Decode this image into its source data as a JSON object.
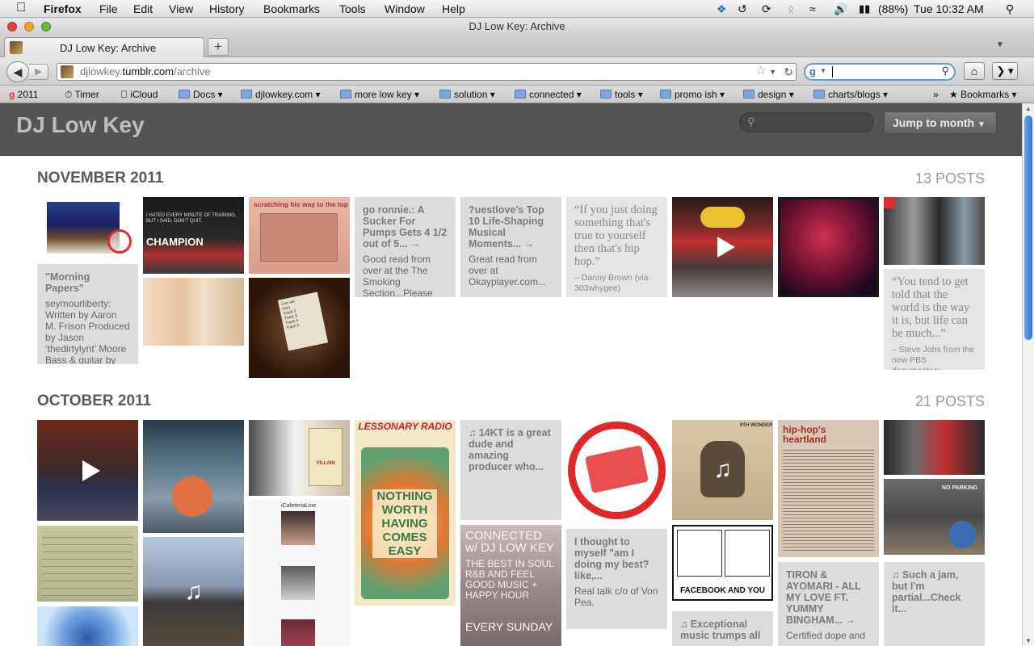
{
  "menubar": {
    "app": "Firefox",
    "items": [
      "File",
      "Edit",
      "View",
      "History",
      "Bookmarks",
      "Tools",
      "Window",
      "Help"
    ],
    "battery": "(88%)",
    "clock": "Tue 10:32 AM"
  },
  "window": {
    "title": "DJ Low Key: Archive"
  },
  "tab": {
    "label": "DJ Low Key: Archive",
    "new_tab": "+"
  },
  "address": {
    "prefix": "djlowkey.",
    "domain": "tumblr.com",
    "path": "/archive"
  },
  "search": {
    "value": ""
  },
  "bookmarks": [
    {
      "label": "2011",
      "icon": "google-icon"
    },
    {
      "label": "Timer",
      "icon": "timer-icon"
    },
    {
      "label": "iCloud",
      "icon": "apple-icon"
    },
    {
      "label": "Docs",
      "icon": "folder-icon",
      "menu": true
    },
    {
      "label": "djlowkey.com",
      "icon": "folder-icon",
      "menu": true
    },
    {
      "label": "more low key",
      "icon": "folder-icon",
      "menu": true
    },
    {
      "label": "solution",
      "icon": "folder-icon",
      "menu": true
    },
    {
      "label": "connected",
      "icon": "folder-icon",
      "menu": true
    },
    {
      "label": "tools",
      "icon": "folder-icon",
      "menu": true
    },
    {
      "label": "promo ish",
      "icon": "folder-icon",
      "menu": true
    },
    {
      "label": "design",
      "icon": "folder-icon",
      "menu": true
    },
    {
      "label": "charts/blogs",
      "icon": "folder-icon",
      "menu": true
    }
  ],
  "bookmarks_menu": "Bookmarks",
  "blog": {
    "title": "DJ Low Key",
    "jump_label": "Jump to month",
    "search_placeholder": ""
  },
  "months": [
    {
      "label": "NOVEMBER 2011",
      "count": "13 POSTS"
    },
    {
      "label": "OCTOBER 2011",
      "count": "21 POSTS"
    }
  ],
  "nov_posts": {
    "morning": {
      "title": "\"Morning Papers\"",
      "body": "seymourliberty: Written by Aaron M. Frison Produced by Jason ‘thedirtylynt’ Moore Bass & guitar by Mugpush Dont u bring me no mornin"
    },
    "ronnie": {
      "title": "go ronnie.: A Sucker For Pumps Gets 4 1/2 out of 5... →",
      "body": "Good read from over at the The Smoking Section...Please don't sleep on this"
    },
    "questlove": {
      "title": "?uestlove's Top 10 Life-Shaping Musical Moments... →",
      "body": "Great read from over at Okayplayer.com..."
    },
    "hiphop_quote": {
      "quote": "“If you just doing something that's true to yourself then that's hip hop.”",
      "source": "– Danny Brown (via 303whygee)"
    },
    "jobs_quote": {
      "quote": "“You tend to get told that the world is the way it is, but life can be much...”",
      "source": "– Steve Jobs from the new PBS documentary"
    }
  },
  "oct_posts": {
    "fourteen": {
      "title": "♫ 14KT is a great dude and amazing producer who..."
    },
    "best": {
      "title": "I thought to myself \"am I doing my best? like,...",
      "body": "Real talk c/o of Von Pea."
    },
    "tiron": {
      "title": "TIRON & AYOMARI - ALL MY LOVE FT. YUMMY BINGHAM... →",
      "body": "Certified dope and"
    },
    "jam": {
      "title": "♫ Such a jam, but I'm partial...Check it..."
    },
    "exceptional": {
      "title": "♫ Exceptional music trumps all"
    }
  },
  "image_text": {
    "scratching": "scratching his way to the top",
    "champion": "CHAMPION",
    "lessonary": "LESSONARY RADIO",
    "nothing": "NOTHING WORTH HAVING COMES EASY",
    "connected": "CONNECTED w/ DJ LOW KEY",
    "connected_sub": "THE BEST IN SOUL R&B AND FEEL GOOD MUSIC + HAPPY HOUR",
    "connected_day": "EVERY SUNDAY",
    "facebook": "FACEBOOK AND YOU",
    "heartland": "hip-hop's heartland",
    "cafeteria": "iCafeteriaLine",
    "villain": "VILLAIN",
    "nine": "9TH WONDER",
    "no_parking": "NO PARKING"
  },
  "colors": {
    "header_bg": "#545454",
    "tile_bg": "#dcdcdc",
    "accent": "#d8302e",
    "scroll": "#2e78d1"
  }
}
